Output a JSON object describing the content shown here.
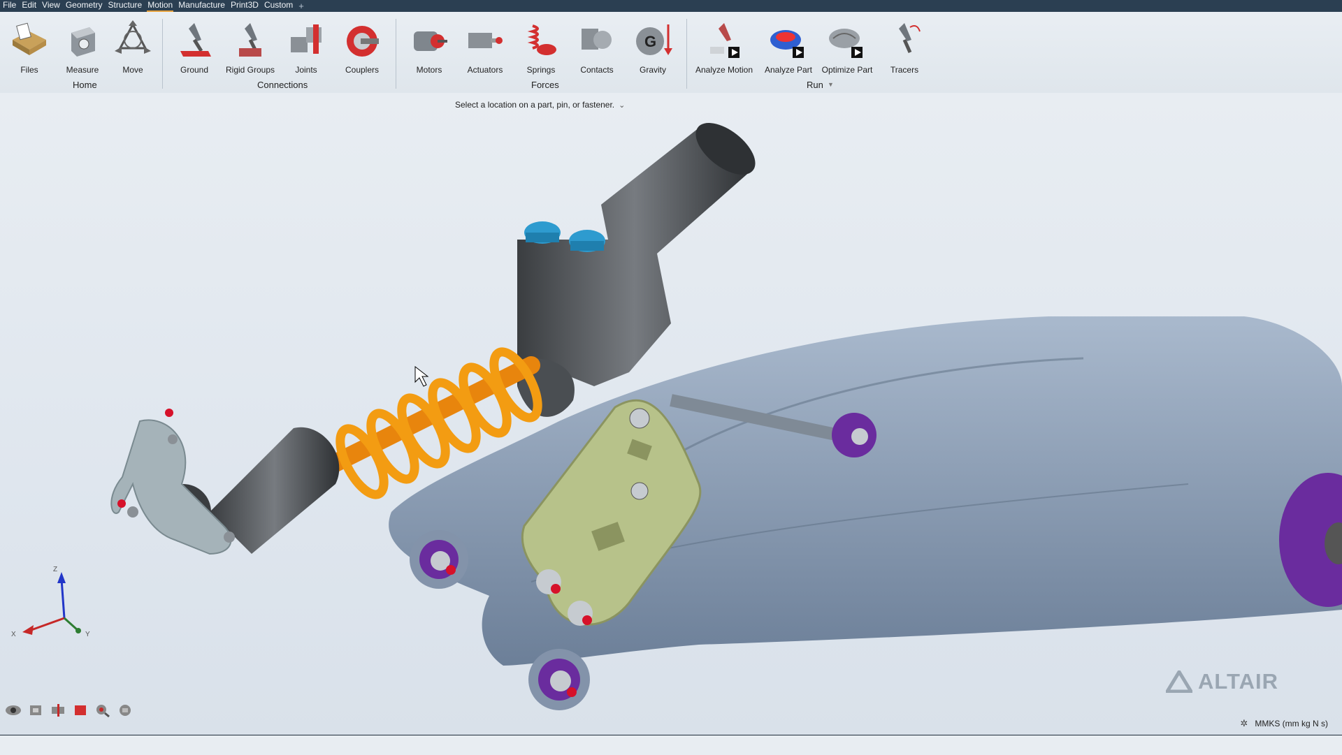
{
  "menu": {
    "items": [
      {
        "label": "File"
      },
      {
        "label": "Edit"
      },
      {
        "label": "View"
      },
      {
        "label": "Geometry"
      },
      {
        "label": "Structure"
      },
      {
        "label": "Motion",
        "active": true
      },
      {
        "label": "Manufacture"
      },
      {
        "label": "Print3D"
      },
      {
        "label": "Custom"
      }
    ],
    "add_symbol": "+"
  },
  "ribbon": {
    "groups": {
      "home": {
        "label": "Home",
        "tools": [
          {
            "label": "Files",
            "icon": "files-icon"
          },
          {
            "label": "Measure",
            "icon": "measure-icon"
          },
          {
            "label": "Move",
            "icon": "move-icon"
          }
        ]
      },
      "connections": {
        "label": "Connections",
        "tools": [
          {
            "label": "Ground",
            "icon": "ground-icon"
          },
          {
            "label": "Rigid Groups",
            "icon": "rigid-groups-icon"
          },
          {
            "label": "Joints",
            "icon": "joints-icon"
          },
          {
            "label": "Couplers",
            "icon": "couplers-icon"
          }
        ]
      },
      "forces": {
        "label": "Forces",
        "tools": [
          {
            "label": "Motors",
            "icon": "motors-icon"
          },
          {
            "label": "Actuators",
            "icon": "actuators-icon"
          },
          {
            "label": "Springs",
            "icon": "springs-icon"
          },
          {
            "label": "Contacts",
            "icon": "contacts-icon"
          },
          {
            "label": "Gravity",
            "icon": "gravity-icon"
          }
        ]
      },
      "run": {
        "label": "Run",
        "tools": [
          {
            "label": "Analyze Motion",
            "icon": "analyze-motion-icon"
          },
          {
            "label": "Analyze Part",
            "icon": "analyze-part-icon"
          },
          {
            "label": "Optimize Part",
            "icon": "optimize-part-icon"
          }
        ]
      },
      "extra": {
        "tools": [
          {
            "label": "Tracers",
            "icon": "tracers-icon"
          }
        ]
      }
    }
  },
  "prompt": {
    "text": "Select a location on a part, pin, or fastener."
  },
  "axes": {
    "z": "Z",
    "x": "X",
    "y": "Y"
  },
  "status": {
    "units": "MMKS (mm kg N s)"
  },
  "watermark": {
    "brand": "ALTAIR"
  },
  "colors": {
    "menubar": "#2b3f52",
    "accent": "#e6a23c",
    "spring": "#f39c12",
    "swingarm": "#7f93ab",
    "bracket": "#b7c28a",
    "bushing": "#6a2c9e",
    "bolt": "#2e9bcf"
  }
}
